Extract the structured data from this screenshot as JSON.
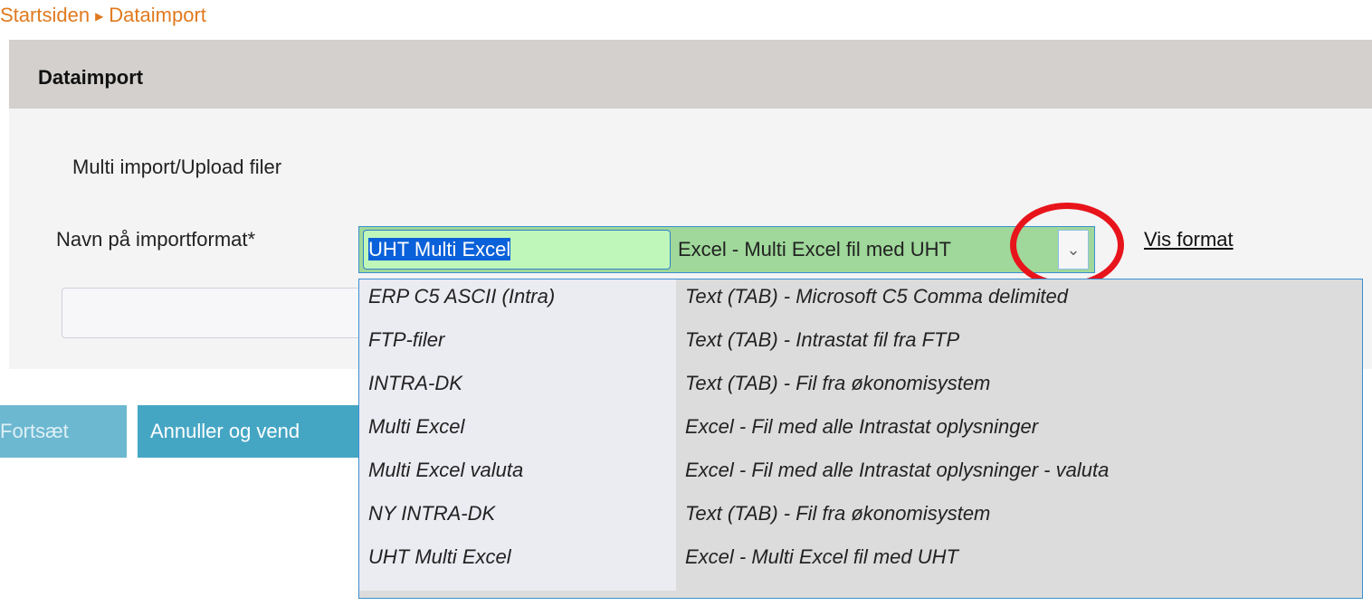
{
  "breadcrumb": {
    "home": "Startsiden",
    "separator": "▶",
    "current": "Dataimport"
  },
  "panel": {
    "title": "Dataimport"
  },
  "form": {
    "section_title": "Multi import/Upload filer",
    "format_label": "Navn på importformat*",
    "selected_code": "UHT Multi Excel",
    "selected_desc": "Excel - Multi Excel fil med UHT",
    "dropdown_icon": "chevron-double-down-icon",
    "vis_format_link": "Vis format"
  },
  "buttons": {
    "continue": "Fortsæt",
    "cancel": "Annuller og vend"
  },
  "dropdown": {
    "options": [
      {
        "code": "ERP C5 ASCII (Intra)",
        "desc": "Text (TAB) - Microsoft C5 Comma delimited"
      },
      {
        "code": "FTP-filer",
        "desc": "Text (TAB) - Intrastat fil fra FTP"
      },
      {
        "code": "INTRA-DK",
        "desc": "Text (TAB) - Fil fra økonomisystem"
      },
      {
        "code": "Multi Excel",
        "desc": "Excel - Fil med alle Intrastat oplysninger"
      },
      {
        "code": "Multi Excel valuta",
        "desc": "Excel - Fil med alle Intrastat oplysninger - valuta"
      },
      {
        "code": "NY INTRA-DK",
        "desc": "Text (TAB) - Fil fra økonomisystem"
      },
      {
        "code": "UHT Multi Excel",
        "desc": "Excel - Multi Excel fil med UHT"
      }
    ]
  },
  "colors": {
    "breadcrumb": "#e07a1f",
    "header_bg": "#d3d0cd",
    "button_bg": "#45a6c4",
    "highlight_ring": "#e8141b",
    "combo_bg": "#9fd89a",
    "selection": "#0a61d9"
  }
}
